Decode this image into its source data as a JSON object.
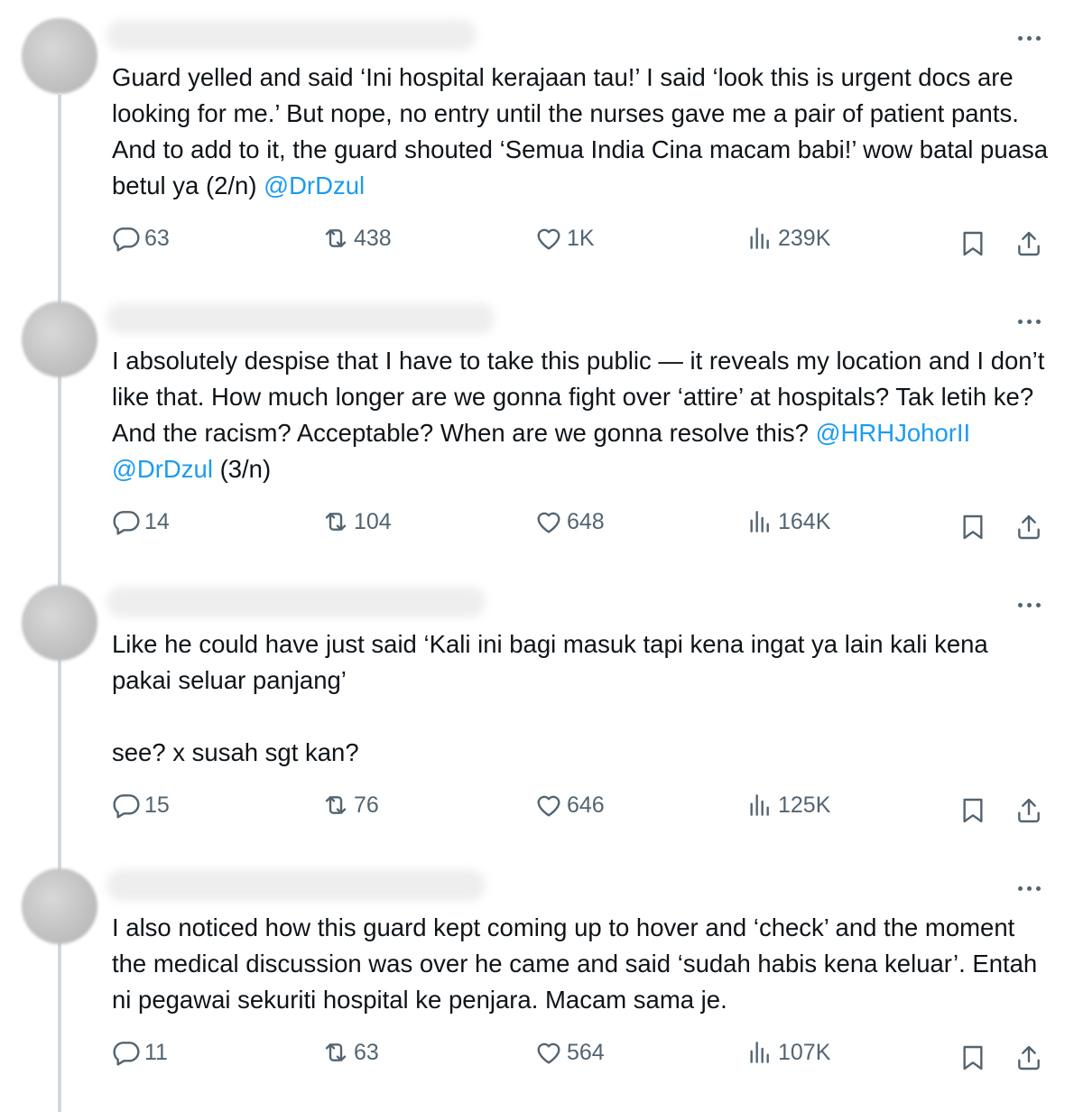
{
  "tweets": [
    {
      "text_parts": [
        "Guard yelled and said ‘Ini hospital kerajaan tau!’ I said ‘look this is urgent docs are looking for me.’ But nope, no entry until the nurses gave me a pair of patient pants. And to add to it, the guard shouted ‘Semua India Cina macam babi!’ wow batal puasa betul ya (2/n) "
      ],
      "mentions": [
        "@DrDzul"
      ],
      "replies": "63",
      "reposts": "438",
      "likes": "1K",
      "views": "239K"
    },
    {
      "text_parts": [
        "I absolutely despise that I have to take this public — it reveals my location and I don’t like that. How much longer are we gonna fight over ‘attire’ at hospitals? Tak letih ke? And the racism? Acceptable? When are we gonna resolve this? ",
        " (3/n)"
      ],
      "mentions": [
        "@HRHJohorII",
        "@DrDzul"
      ],
      "replies": "14",
      "reposts": "104",
      "likes": "648",
      "views": "164K"
    },
    {
      "text_parts": [
        "Like he could have just said ‘Kali ini bagi masuk tapi kena ingat ya lain kali kena pakai seluar panjang’",
        "see? x susah sgt kan?"
      ],
      "replies": "15",
      "reposts": "76",
      "likes": "646",
      "views": "125K"
    },
    {
      "text_parts": [
        "I also noticed how this guard kept coming up to hover and ‘check’ and the moment the medical discussion was over he came and said ‘sudah habis kena keluar’. Entah ni pegawai sekuriti hospital ke penjara. Macam sama je."
      ],
      "replies": "11",
      "reposts": "63",
      "likes": "564",
      "views": "107K"
    }
  ],
  "colors": {
    "text": "#0f1419",
    "secondary": "#536471",
    "mention": "#1d9bf0",
    "thread_line": "#cfd9de"
  },
  "icons": [
    "more-icon",
    "reply-icon",
    "repost-icon",
    "like-icon",
    "views-icon",
    "bookmark-icon",
    "share-icon"
  ]
}
